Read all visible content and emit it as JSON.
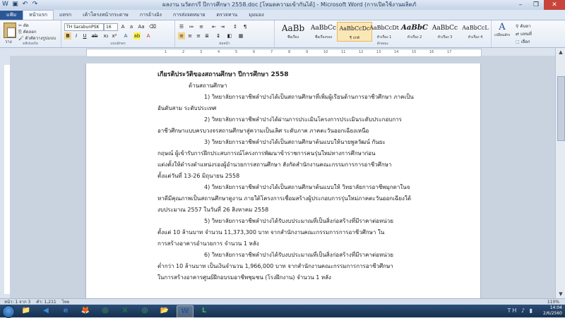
{
  "window": {
    "title": "ผลงาน นวัตกรรี ปีการศึกษา 2558.doc [โหมดความเข้ากันได้] - Microsoft Word (การเปิดใช้งานผลิตภัณฑ์ล้มเหลว)",
    "controls": {
      "minimize": "–",
      "maximize": "❐",
      "close": "✕"
    }
  },
  "ribbon_tabs": [
    "แฟ้ม",
    "หน้าแรก",
    "แทรก",
    "เค้าโครงหน้ากระดาษ",
    "การอ้างอิง",
    "การส่งจดหมาย",
    "ตรวจทาน",
    "มุมมอง"
  ],
  "ribbon": {
    "clipboard": {
      "paste_label": "วาง",
      "cut": "ตัด",
      "copy": "คัดลอก",
      "format_painter": "ตัวคัดวางรูปแบบ",
      "group_label": "คลิปบอร์ด"
    },
    "font": {
      "font_name": "TH SarabunPSK",
      "font_size": "16",
      "group_label": "แบบอักษร"
    },
    "paragraph": {
      "group_label": "ย่อหน้า"
    },
    "styles": {
      "items": [
        {
          "sample": "AaBb",
          "name": "ชื่อเรื่อง"
        },
        {
          "sample": "AaBbCc",
          "name": "ชื่อเรื่องรอง"
        },
        {
          "sample": "AaBbCcDc",
          "name": "¶ ปกติ"
        },
        {
          "sample": "AaBbCcDt",
          "name": "หัวเรื่อง 1"
        },
        {
          "sample": "AaBbC",
          "name": "หัวเรื่อง 2"
        },
        {
          "sample": "AaBbCc",
          "name": "หัวเรื่อง 3"
        },
        {
          "sample": "AaBbCcL",
          "name": "หัวเรื่อง 4"
        }
      ],
      "change_styles": "เปลี่ยนลักษณะ",
      "group_label": "ลักษณะ"
    },
    "editing": {
      "find": "ค้นหา",
      "replace": "แทนที่",
      "select": "เลือก"
    }
  },
  "ruler_ticks": [
    "1",
    "2",
    "3",
    "4",
    "5",
    "6",
    "7",
    "8",
    "9",
    "10",
    "11",
    "12",
    "13",
    "14",
    "15",
    "16",
    "17"
  ],
  "document": {
    "title": "เกียรติประวัติของสถานศึกษา  ปีการศึกษา 2558",
    "subtitle": "ด้านสถานศึกษา",
    "lines": [
      {
        "indent": "indent2",
        "text": "1) วิทยาลัยการอาชีพลำปางได้เป็นสถานศึกษาที่เพิ่มผู้เรียนด้านการอาชีวศึกษา ภาคเป็น"
      },
      {
        "indent": "",
        "text": "อันดับสาม ระดับประเทศ"
      },
      {
        "indent": "indent2",
        "text": "2)  วิทยาลัยการอาชีพลำปางได้ผ่านการประเมินโครงการประเมินระดับประกอบการ"
      },
      {
        "indent": "",
        "text": "อาชีวศึกษาแบบครบวงจรสถานศึกษาสู่ความเป็นเลิศ ระดับภาค ภาคตะวันออกเฉียงเหนือ"
      },
      {
        "indent": "indent2",
        "text": "3) วิทยาลัยการอาชีพลำปางได้เป็นสถานศึกษาต้นแบบให้นายพูลวัฒน์ กันยะ"
      },
      {
        "indent": "",
        "text": "กฤษณ์  ผู้เข้ารับการฝึกประสบการณ์โครงการพัฒนาข้าราชการคนรุ่นใหม่ทางการศึกษาก่อน"
      },
      {
        "indent": "",
        "text": "แต่งตั้งให้ดำรงตำแหน่งรองผู้อำนวยการสถานศึกษา สังกัดสำนักงานคณะกรรมการการอาชีวศึกษา"
      },
      {
        "indent": "",
        "text": "ตั้งแต่วันที่ 13-26 มิถุนายน 2558"
      },
      {
        "indent": "indent2",
        "text": "4) วิทยาลัยการอาชีพลำปางได้เป็นสถานศึกษาต้นแบบให้ วิทยาลัยการอาชีพมุกดาในจ"
      },
      {
        "indent": "",
        "text": "หาดีมีคุณภาพเป็นสถานศึกษาดูงาน ภายใต้โครงการเชื่อมสร้างผู้ประกอบการรุ่นใหม่ภาคตะวันออกเฉียงใต้"
      },
      {
        "indent": "",
        "text": "งบประมาณ 2557 ในวันที่ 26 สิงหาคม 2558"
      },
      {
        "indent": "indent2",
        "text": "5) วิทยาลัยการอาชีพลำปางได้รับงบประมาณที่เป็นสิ่งก่อสร้างที่มีราคาต่อหน่วย"
      },
      {
        "indent": "",
        "text": "ตั้งแต่ 10 ล้านบาท  จำนวน 11,373,300 บาท  จากสำนักงานคณะกรรมการการอาชีวศึกษา   ใน"
      },
      {
        "indent": "",
        "text": "การสร้างอาคารอำนวยการ จำนวน 1 หลัง"
      },
      {
        "indent": "indent2",
        "text": "6) วิทยาลัยการอาชีพลำปางได้รับงบประมาณที่เป็นสิ่งก่อสร้างที่มีราคาต่อหน่วย"
      },
      {
        "indent": "",
        "text": "ต่ำกว่า 10 ล้านบาท  เป็นเงินจำนวน  1,966,000 บาท  จากสำนักงานคณะกรรมการการอาชีวศึกษา"
      },
      {
        "indent": "",
        "text": "ในการสร้างอาคารศูนย์ฝึกอบรมอาชีพชุมชน (โรงฝึกงาน) จำนวน 1 หลัง"
      }
    ]
  },
  "status_bar": {
    "page": "หน้า: 1 จาก 3",
    "words": "คำ: 1,211",
    "language": "ไทย",
    "zoom": "110%"
  },
  "taskbar": {
    "apps": [
      {
        "icon": "📁",
        "name": "explorer-icon"
      },
      {
        "icon": "◀",
        "name": "media-player-icon"
      },
      {
        "icon": "e",
        "name": "internet-explorer-icon"
      },
      {
        "icon": "🦊",
        "name": "firefox-icon"
      },
      {
        "icon": "◎",
        "name": "chrome-icon"
      },
      {
        "icon": "X",
        "name": "excel-icon"
      },
      {
        "icon": "◎",
        "name": "chrome-alt-icon"
      },
      {
        "icon": "📂",
        "name": "folder-icon"
      },
      {
        "icon": "W",
        "name": "word-icon"
      },
      {
        "icon": "L",
        "name": "line-icon"
      }
    ],
    "clock_time": "14:04",
    "clock_date": "2/6/2560",
    "tray_language": "TH"
  },
  "colors": {
    "word_blue": "#2b5797",
    "taskbar": "#1f3b5f",
    "page": "#ffffff"
  }
}
